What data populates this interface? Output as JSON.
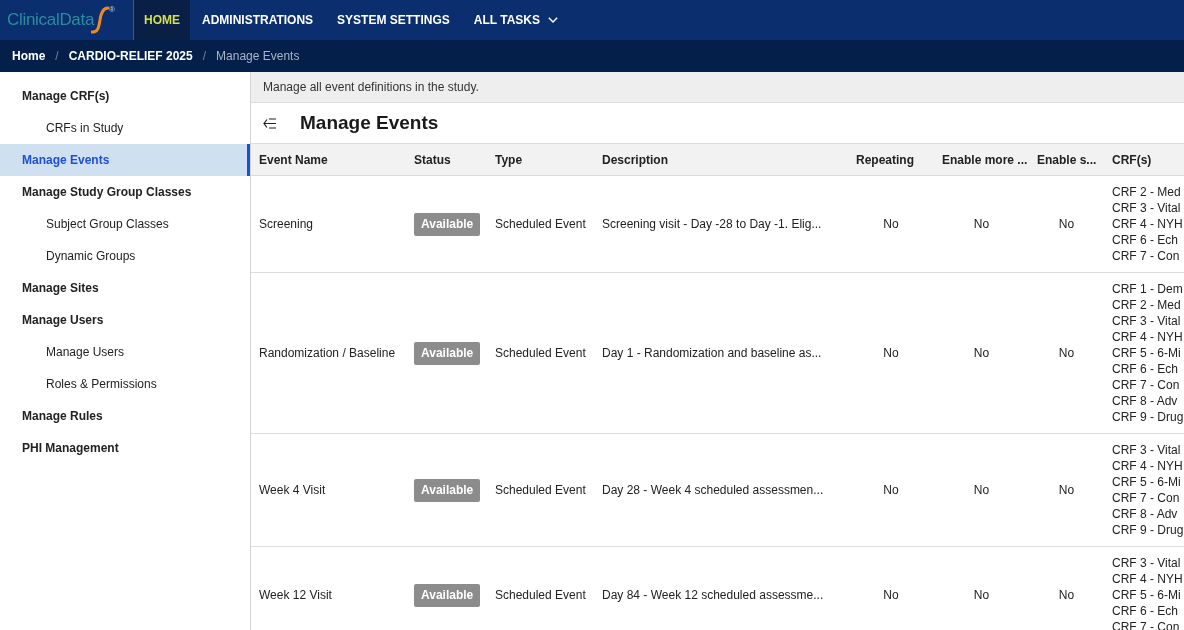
{
  "header": {
    "logo": {
      "text": "ClinicalData",
      "mark": "®"
    },
    "tabs": [
      {
        "label": "HOME",
        "selected": true,
        "kind": "link"
      },
      {
        "label": "ADMINISTRATIONS",
        "selected": false,
        "kind": "link"
      },
      {
        "label": "SYSTEM SETTINGS",
        "selected": false,
        "kind": "link"
      },
      {
        "label": "ALL TASKS",
        "selected": false,
        "kind": "dropdown"
      }
    ]
  },
  "breadcrumb": [
    {
      "label": "Home",
      "current": false
    },
    {
      "separator": "/",
      "label": "CARDIO-RELIEF 2025",
      "current": false
    },
    {
      "separator": "/",
      "label": "Manage Events",
      "current": true
    }
  ],
  "sidebar": {
    "items": [
      {
        "label": "Manage CRF(s)",
        "selected": false,
        "children": [
          {
            "label": "CRFs in Study",
            "selected": false
          }
        ]
      },
      {
        "label": "Manage Events",
        "selected": true
      },
      {
        "label": "Manage Study Group Classes",
        "selected": false,
        "children": [
          {
            "label": "Subject Group Classes",
            "selected": false
          },
          {
            "label": "Dynamic Groups",
            "selected": false
          }
        ]
      },
      {
        "label": "Manage Sites",
        "selected": false
      },
      {
        "label": "Manage Users",
        "selected": false,
        "children": [
          {
            "label": "Manage Users",
            "selected": false
          },
          {
            "label": "Roles & Permissions",
            "selected": false
          }
        ]
      },
      {
        "label": "Manage Rules",
        "selected": false
      },
      {
        "label": "PHI Management",
        "selected": false
      }
    ]
  },
  "page": {
    "notice": "Manage all event definitions in the study.",
    "title": "Manage Events"
  },
  "table": {
    "columns": [
      {
        "label": "Event Name",
        "kind": "text"
      },
      {
        "label": "Status",
        "kind": "badge"
      },
      {
        "label": "Type",
        "kind": "text"
      },
      {
        "label": "Description",
        "kind": "text"
      },
      {
        "label": "Repeating",
        "kind": "flag"
      },
      {
        "label": "Enable more ...",
        "kind": "flag"
      },
      {
        "label": "Enable s...",
        "kind": "flag"
      },
      {
        "label": "CRF(s)",
        "kind": "list"
      }
    ],
    "rows": [
      {
        "cells": [
          "Screening",
          "Available",
          "Scheduled Event",
          "Screening visit - Day -28 to Day -1. Elig...",
          "No",
          "No",
          "No",
          [
            "CRF 2 - Med",
            "CRF 3 - Vital",
            "CRF 4 - NYH",
            "CRF 6 - Ech",
            "CRF 7 - Con"
          ]
        ]
      },
      {
        "cells": [
          "Randomization / Baseline",
          "Available",
          "Scheduled Event",
          "Day 1 - Randomization and baseline as...",
          "No",
          "No",
          "No",
          [
            "CRF 1 - Dem",
            "CRF 2 - Med",
            "CRF 3 - Vital",
            "CRF 4 - NYH",
            "CRF 5 - 6-Mi",
            "CRF 6 - Ech",
            "CRF 7 - Con",
            "CRF 8 - Adv",
            "CRF 9 - Drug"
          ]
        ]
      },
      {
        "cells": [
          "Week 4 Visit",
          "Available",
          "Scheduled Event",
          "Day 28 - Week 4 scheduled assessmen...",
          "No",
          "No",
          "No",
          [
            "CRF 3 - Vital",
            "CRF 4 - NYH",
            "CRF 5 - 6-Mi",
            "CRF 7 - Con",
            "CRF 8 - Adv",
            "CRF 9 - Drug"
          ]
        ]
      },
      {
        "cells": [
          "Week 12 Visit",
          "Available",
          "Scheduled Event",
          "Day 84 - Week 12 scheduled assessme...",
          "No",
          "No",
          "No",
          [
            "CRF 3 - Vital",
            "CRF 4 - NYH",
            "CRF 5 - 6-Mi",
            "CRF 6 - Ech",
            "CRF 7 - Con"
          ]
        ]
      }
    ]
  }
}
